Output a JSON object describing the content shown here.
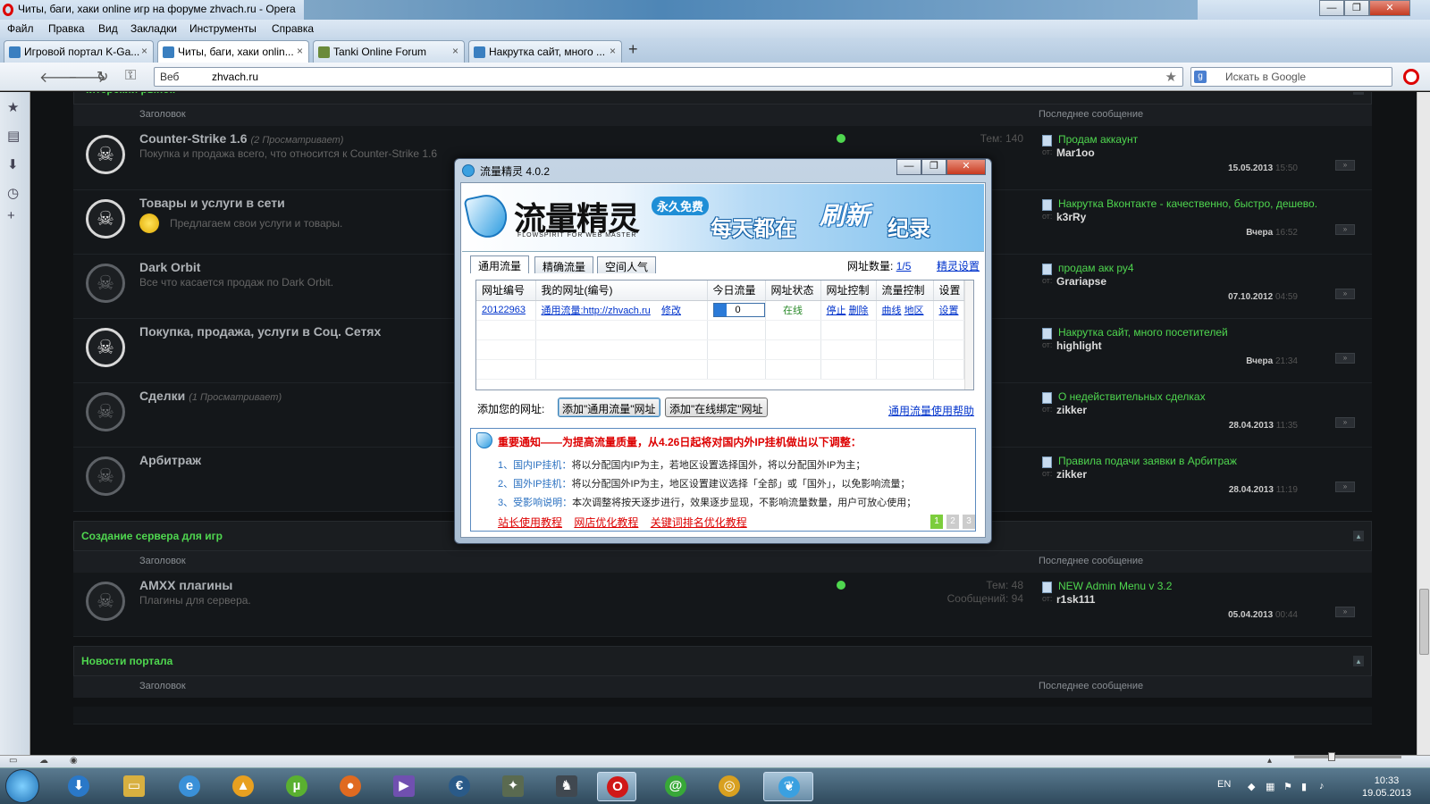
{
  "window": {
    "title": "Читы, баги, хаки online игр на форуме zhvach.ru - Opera",
    "controls": {
      "minimize": "—",
      "maximize": "❐",
      "close": "✕"
    }
  },
  "menu": [
    "Файл",
    "Правка",
    "Вид",
    "Закладки",
    "Инструменты",
    "Справка"
  ],
  "tabs": [
    {
      "label": "Игровой портал K-Ga...",
      "active": false
    },
    {
      "label": "Читы, баги, хаки onlin...",
      "active": true
    },
    {
      "label": "Tanki Online Forum",
      "active": false
    },
    {
      "label": "Накрутка сайт, много ...",
      "active": false
    }
  ],
  "tab_close": "×",
  "new_tab": "+",
  "address": {
    "prefix": "Веб",
    "url": "zhvach.ru"
  },
  "search": {
    "placeholder": "Искать в Google",
    "engine_icon": "g"
  },
  "nav_icons": {
    "back": "🡐",
    "forward": "🡒",
    "reload": "↻",
    "key": "⚿",
    "star": "★"
  },
  "sidebar_icons": {
    "bookmarks": "★",
    "notes": "▤",
    "downloads": "⬇",
    "history": "◷",
    "add": "+"
  },
  "forum": {
    "collapse_glyph": "▴",
    "skull": "☠",
    "go_glyph": "»",
    "by": "от:",
    "sections": [
      {
        "title": "Читерский рынок",
        "col_subject": "Заголовок",
        "col_last": "Последнее сообщение",
        "rows": [
          {
            "name": "Counter-Strike 1.6",
            "viewers": "(2 Просматривает)",
            "desc": "Покупка и продажа всего, что относится к Counter-Strike 1.6",
            "stats1": "Тем: 140",
            "stats2": "",
            "online": true,
            "last_title": "Продам аккаунт",
            "last_author": "Mar1oo",
            "last_date": "15.05.2013",
            "last_time": "15:50",
            "bright": true
          },
          {
            "name": "Товары и услуги в сети",
            "viewers": "",
            "desc": "Предлагаем свои услуги и товары.",
            "stats1": "",
            "stats2": "",
            "online": false,
            "last_title": "Накрутка Вконтакте - качественно, быстро, дешево.",
            "last_author": "k3rRy",
            "last_date": "Вчера",
            "last_time": "16:52",
            "bright": true,
            "sun": true
          },
          {
            "name": "Dark Orbit",
            "viewers": "",
            "desc": "Все что касается продаж по Dark Orbit.",
            "stats1": "",
            "stats2": "",
            "online": false,
            "last_title": "продам акк ру4",
            "last_author": "Grariapse",
            "last_date": "07.10.2012",
            "last_time": "04:59",
            "bright": false
          },
          {
            "name": "Покупка, продажа, услуги в Соц. Сетях",
            "viewers": "",
            "desc": "",
            "stats1": "",
            "stats2": "",
            "online": false,
            "last_title": "Накрутка сайт, много посетителей",
            "last_author": "highlight",
            "last_date": "Вчера",
            "last_time": "21:34",
            "bright": true
          },
          {
            "name": "Сделки",
            "viewers": "(1 Просматривает)",
            "desc": "",
            "stats1": "",
            "stats2": "",
            "online": false,
            "last_title": "О недействительных сделках",
            "last_author": "zikker",
            "last_date": "28.04.2013",
            "last_time": "11:35",
            "bright": false
          },
          {
            "name": "Арбитраж",
            "viewers": "",
            "desc": "",
            "stats1": "",
            "stats2": "",
            "online": false,
            "last_title": "Правила подачи заявки в Арбитраж",
            "last_author": "zikker",
            "last_date": "28.04.2013",
            "last_time": "11:19",
            "bright": false
          }
        ]
      },
      {
        "title": "Создание сервера для игр",
        "col_subject": "Заголовок",
        "col_last": "Последнее сообщение",
        "rows": [
          {
            "name": "AMXX плагины",
            "viewers": "",
            "desc": "Плагины для сервера.",
            "stats1": "Тем: 48",
            "stats2": "Сообщений: 94",
            "online": true,
            "last_title": "NEW Admin Menu v 3.2",
            "last_author": "r1sk111",
            "last_date": "05.04.2013",
            "last_time": "00:44",
            "bright": false
          }
        ]
      },
      {
        "title": "Новости портала",
        "col_subject": "Заголовок",
        "col_last": "Последнее сообщение",
        "rows": []
      }
    ]
  },
  "dialog": {
    "title": "流量精灵 4.0.2",
    "banner": {
      "name": "流量精灵",
      "sub": "FLOWSPIRIT FOR WEB MASTER",
      "free": "永久免费",
      "slogan1": "每天都在",
      "slogan2": "刷新",
      "slogan3": "纪录"
    },
    "tabs": [
      "通用流量",
      "精确流量",
      "空间人气"
    ],
    "url_count_label": "网址数量:",
    "url_count": "1/5",
    "settings_link": "精灵设置",
    "columns": [
      "网址编号",
      "我的网址(编号)",
      "今日流量",
      "网址状态",
      "网址控制",
      "流量控制",
      "设置"
    ],
    "row": {
      "id": "20122963",
      "url": "通用流量:http://zhvach.ru",
      "edit": "修改",
      "traffic": "0",
      "traffic_fill_fraction": 0.25,
      "status": "在线",
      "stop": "停止",
      "delete": "删除",
      "curve": "曲线",
      "region": "地区",
      "setup": "设置"
    },
    "add_label": "添加您的网址:",
    "add_btn1": "添加\"通用流量\"网址",
    "add_btn2": "添加\"在线绑定\"网址",
    "help_link": "通用流量使用帮助",
    "notice": {
      "title": "重要通知——为提高流量质量，从4.26日起将对国内外IP挂机做出以下调整：",
      "lines": [
        {
          "num": "1、",
          "key": "国内IP挂机：",
          "text": "将以分配国内IP为主，若地区设置选择国外，将以分配国外IP为主；"
        },
        {
          "num": "2、",
          "key": "国外IP挂机：",
          "text": "将以分配国外IP为主，地区设置建议选择「全部」或「国外」，以免影响流量；"
        },
        {
          "num": "3、",
          "key": "受影响说明：",
          "text": "本次调整将按天逐步进行，效果逐步显现，不影响流量数量，用户可放心使用；"
        }
      ],
      "links": [
        "站长使用教程",
        "网店优化教程",
        "关键词排名优化教程"
      ],
      "pages": [
        "1",
        "2",
        "3"
      ]
    }
  },
  "taskbar": {
    "lang": "EN",
    "time": "10:33",
    "date": "19.05.2013"
  }
}
